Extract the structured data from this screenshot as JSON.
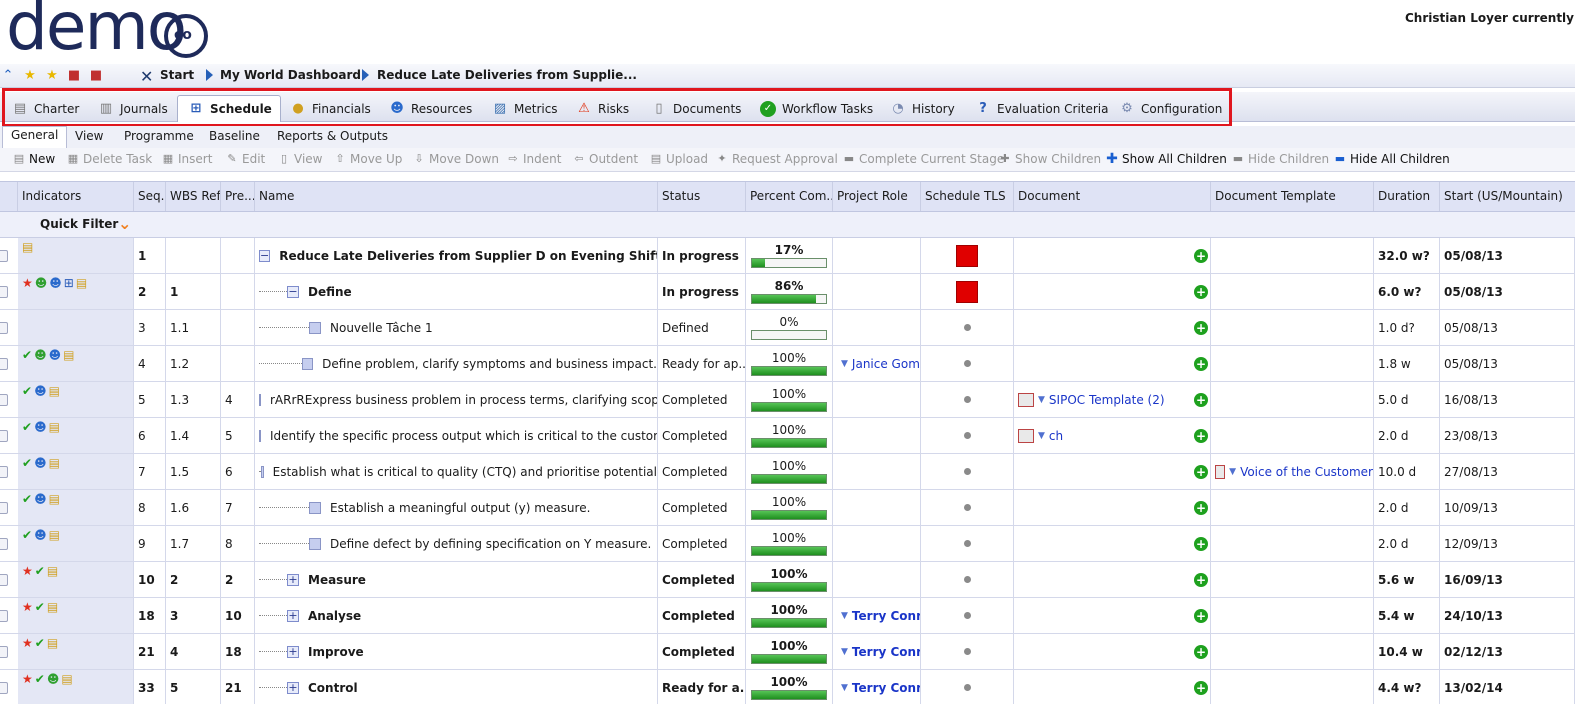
{
  "header": {
    "logo_text": "demo",
    "logo_co": "co",
    "user_text": "Christian Loyer currently in"
  },
  "breadcrumb": {
    "start": "Start",
    "dashboard": "My World Dashboard",
    "current": "Reduce Late Deliveries from Supplie..."
  },
  "tabs": [
    {
      "label": "Charter",
      "icon": "charter-icon"
    },
    {
      "label": "Journals",
      "icon": "journals-icon"
    },
    {
      "label": "Schedule",
      "icon": "schedule-icon",
      "active": true
    },
    {
      "label": "Financials",
      "icon": "financials-icon"
    },
    {
      "label": "Resources",
      "icon": "resources-icon"
    },
    {
      "label": "Metrics",
      "icon": "metrics-icon"
    },
    {
      "label": "Risks",
      "icon": "risks-icon"
    },
    {
      "label": "Documents",
      "icon": "documents-icon"
    },
    {
      "label": "Workflow Tasks",
      "icon": "workflow-icon"
    },
    {
      "label": "History",
      "icon": "history-icon"
    },
    {
      "label": "Evaluation Criteria",
      "icon": "evaluation-icon"
    },
    {
      "label": "Configuration",
      "icon": "configuration-icon"
    }
  ],
  "subtabs": [
    "General",
    "View",
    "Programme",
    "Baseline",
    "Reports & Outputs"
  ],
  "toolbar": [
    {
      "label": "New",
      "enabled": true
    },
    {
      "label": "Delete Task",
      "enabled": false
    },
    {
      "label": "Insert",
      "enabled": false
    },
    {
      "label": "Edit",
      "enabled": false
    },
    {
      "label": "View",
      "enabled": false
    },
    {
      "label": "Move Up",
      "enabled": false
    },
    {
      "label": "Move Down",
      "enabled": false
    },
    {
      "label": "Indent",
      "enabled": false
    },
    {
      "label": "Outdent",
      "enabled": false
    },
    {
      "label": "Upload",
      "enabled": false
    },
    {
      "label": "Request Approval",
      "enabled": false
    },
    {
      "label": "Complete Current Stage",
      "enabled": false
    },
    {
      "label": "Show Children",
      "enabled": false
    },
    {
      "label": "Show All Children",
      "enabled": true
    },
    {
      "label": "Hide Children",
      "enabled": false
    },
    {
      "label": "Hide All Children",
      "enabled": true
    }
  ],
  "columns": [
    "Indicators",
    "Seq.",
    "WBS Ref.",
    "Pre...",
    "Name",
    "Status",
    "Percent Com...",
    "Project Role",
    "Schedule TLS",
    "Document",
    "Document Template",
    "Duration",
    "Start (US/Mountain)"
  ],
  "quick_filter": "Quick Filter",
  "rows": [
    {
      "seq": "1",
      "wbs": "",
      "pre": "",
      "name": "Reduce Late Deliveries from Supplier D on Evening Shift",
      "status": "In progress",
      "pct": 17,
      "pct_label": "17%",
      "role": "",
      "tls": "red",
      "doc": "",
      "tmpl": "",
      "duration": "32.0 w?",
      "start": "05/08/13",
      "bold": true,
      "level": 0,
      "expander": "minus",
      "indicators": [
        "document-lock-icon"
      ]
    },
    {
      "seq": "2",
      "wbs": "1",
      "pre": "",
      "name": "Define",
      "status": "In progress",
      "pct": 86,
      "pct_label": "86%",
      "role": "",
      "tls": "red",
      "doc": "",
      "tmpl": "",
      "duration": "6.0 w?",
      "start": "05/08/13",
      "bold": true,
      "level": 1,
      "expander": "minus",
      "indicators": [
        "star-icon",
        "person-icon",
        "people-icon",
        "hierarchy-icon",
        "document-lock-icon"
      ]
    },
    {
      "seq": "3",
      "wbs": "1.1",
      "pre": "",
      "name": "Nouvelle Tâche 1",
      "status": "Defined",
      "pct": 0,
      "pct_label": "0%",
      "role": "",
      "tls": "dot",
      "doc": "",
      "tmpl": "",
      "duration": "1.0 d?",
      "start": "05/08/13",
      "bold": false,
      "level": 2,
      "expander": "leaf",
      "indicators": []
    },
    {
      "seq": "4",
      "wbs": "1.2",
      "pre": "",
      "name": "Define problem, clarify symptoms and business impact.",
      "status": "Ready for ap...",
      "pct": 100,
      "pct_label": "100%",
      "role": "Janice Gom",
      "tls": "dot",
      "doc": "",
      "tmpl": "",
      "duration": "1.8 w",
      "start": "05/08/13",
      "bold": false,
      "level": 2,
      "expander": "leaf",
      "indicators": [
        "check-icon",
        "person-icon",
        "people-icon",
        "document-lock-icon"
      ]
    },
    {
      "seq": "5",
      "wbs": "1.3",
      "pre": "4",
      "name": "rARrRExpress business problem in process terms, clarifying scope",
      "status": "Completed",
      "pct": 100,
      "pct_label": "100%",
      "role": "",
      "tls": "dot",
      "doc": "SIPOC Template (2)",
      "tmpl": "",
      "duration": "5.0 d",
      "start": "16/08/13",
      "bold": false,
      "level": 2,
      "expander": "leaf",
      "indicators": [
        "check-icon",
        "people-icon",
        "document-lock-icon"
      ]
    },
    {
      "seq": "6",
      "wbs": "1.4",
      "pre": "5",
      "name": "Identify the specific process output which is critical to the customer",
      "status": "Completed",
      "pct": 100,
      "pct_label": "100%",
      "role": "",
      "tls": "dot",
      "doc": "ch",
      "tmpl": "",
      "duration": "2.0 d",
      "start": "23/08/13",
      "bold": false,
      "level": 2,
      "expander": "leaf",
      "indicators": [
        "check-icon",
        "people-icon",
        "document-lock-icon"
      ]
    },
    {
      "seq": "7",
      "wbs": "1.5",
      "pre": "6",
      "name": "Establish what is critical to quality (CTQ) and prioritise potential",
      "status": "Completed",
      "pct": 100,
      "pct_label": "100%",
      "role": "",
      "tls": "dot",
      "doc": "",
      "tmpl": "Voice of the Customer",
      "duration": "10.0 d",
      "start": "27/08/13",
      "bold": false,
      "level": 2,
      "expander": "leaf",
      "indicators": [
        "check-icon",
        "people-icon",
        "document-lock-icon"
      ]
    },
    {
      "seq": "8",
      "wbs": "1.6",
      "pre": "7",
      "name": "Establish a meaningful output (y) measure.",
      "status": "Completed",
      "pct": 100,
      "pct_label": "100%",
      "role": "",
      "tls": "dot",
      "doc": "",
      "tmpl": "",
      "duration": "2.0 d",
      "start": "10/09/13",
      "bold": false,
      "level": 2,
      "expander": "leaf",
      "indicators": [
        "check-icon",
        "people-icon",
        "document-lock-icon"
      ]
    },
    {
      "seq": "9",
      "wbs": "1.7",
      "pre": "8",
      "name": "Define defect by defining specification on Y measure.",
      "status": "Completed",
      "pct": 100,
      "pct_label": "100%",
      "role": "",
      "tls": "dot",
      "doc": "",
      "tmpl": "",
      "duration": "2.0 d",
      "start": "12/09/13",
      "bold": false,
      "level": 2,
      "expander": "leaf",
      "indicators": [
        "check-icon",
        "people-icon",
        "document-lock-icon"
      ]
    },
    {
      "seq": "10",
      "wbs": "2",
      "pre": "2",
      "name": "Measure",
      "status": "Completed",
      "pct": 100,
      "pct_label": "100%",
      "role": "",
      "tls": "dot",
      "doc": "",
      "tmpl": "",
      "duration": "5.6 w",
      "start": "16/09/13",
      "bold": true,
      "level": 1,
      "expander": "plus",
      "indicators": [
        "star-icon",
        "check-icon",
        "document-lock-icon"
      ]
    },
    {
      "seq": "18",
      "wbs": "3",
      "pre": "10",
      "name": "Analyse",
      "status": "Completed",
      "pct": 100,
      "pct_label": "100%",
      "role": "Terry Conr",
      "tls": "dot",
      "doc": "",
      "tmpl": "",
      "duration": "5.4 w",
      "start": "24/10/13",
      "bold": true,
      "level": 1,
      "expander": "plus",
      "indicators": [
        "star-icon",
        "check-icon",
        "document-lock-icon"
      ]
    },
    {
      "seq": "21",
      "wbs": "4",
      "pre": "18",
      "name": "Improve",
      "status": "Completed",
      "pct": 100,
      "pct_label": "100%",
      "role": "Terry Conr",
      "tls": "dot",
      "doc": "",
      "tmpl": "",
      "duration": "10.4 w",
      "start": "02/12/13",
      "bold": true,
      "level": 1,
      "expander": "plus",
      "indicators": [
        "star-icon",
        "check-icon",
        "document-lock-icon"
      ]
    },
    {
      "seq": "33",
      "wbs": "5",
      "pre": "21",
      "name": "Control",
      "status": "Ready for a...",
      "pct": 100,
      "pct_label": "100%",
      "role": "Terry Conr",
      "tls": "dot",
      "doc": "",
      "tmpl": "",
      "duration": "4.4 w?",
      "start": "13/02/14",
      "bold": true,
      "level": 1,
      "expander": "plus",
      "indicators": [
        "star-icon",
        "check-icon",
        "person-icon",
        "document-lock-icon"
      ]
    }
  ]
}
